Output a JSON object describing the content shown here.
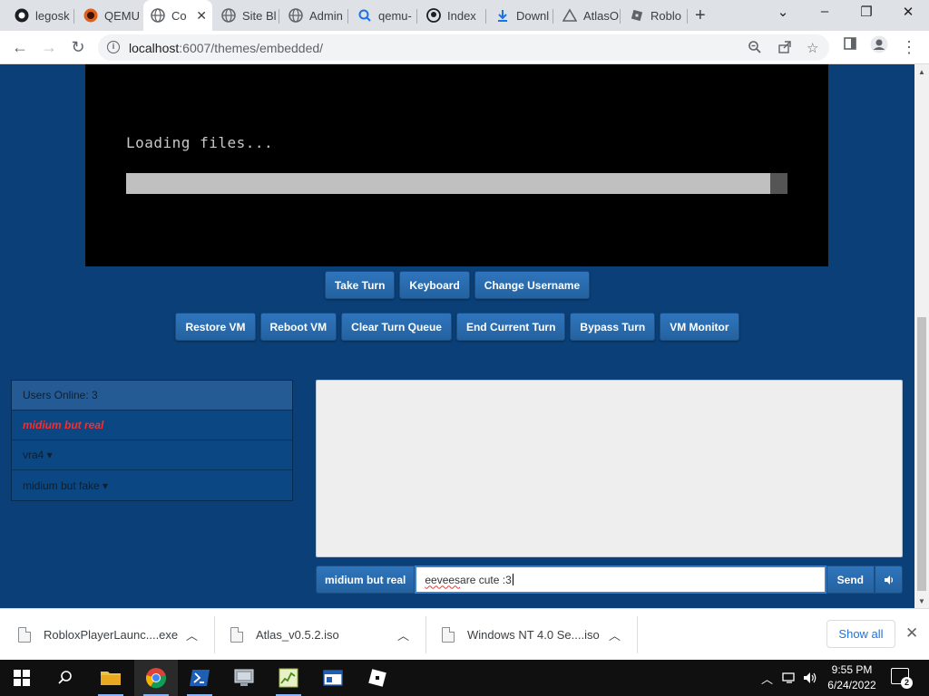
{
  "browser": {
    "tabs": [
      {
        "title": "legosk",
        "icon": "github-icon"
      },
      {
        "title": "QEMU",
        "icon": "qemu-icon"
      },
      {
        "title": "Co",
        "icon": "globe-icon",
        "active": true
      },
      {
        "title": "Site Bl",
        "icon": "globe-icon"
      },
      {
        "title": "Admin",
        "icon": "globe-icon"
      },
      {
        "title": "qemu-",
        "icon": "search-icon"
      },
      {
        "title": "Index",
        "icon": "github-icon"
      },
      {
        "title": "Downl",
        "icon": "download-icon"
      },
      {
        "title": "AtlasO",
        "icon": "atlas-icon"
      },
      {
        "title": "Roblo",
        "icon": "roblox-icon"
      }
    ],
    "url_host": "localhost",
    "url_path": ":6007/themes/embedded/"
  },
  "vm": {
    "loading_text": "Loading files...",
    "progress": 0.974
  },
  "controls": {
    "row1": [
      "Take Turn",
      "Keyboard",
      "Change Username"
    ],
    "row2": [
      "Restore VM",
      "Reboot VM",
      "Clear Turn Queue",
      "End Current Turn",
      "Bypass Turn",
      "VM Monitor"
    ]
  },
  "users": {
    "header": "Users Online: 3",
    "list": [
      {
        "name": "midium but real",
        "self": true
      },
      {
        "name": "vra4 ▾",
        "self": false
      },
      {
        "name": "midium but fake ▾",
        "self": false
      }
    ]
  },
  "chat": {
    "username": "midium but real",
    "input_word1": "eevees",
    "input_rest": " are cute :3",
    "send_label": "Send",
    "sound_icon": "speaker-icon"
  },
  "downloads": {
    "items": [
      {
        "name": "RobloxPlayerLaunc....exe"
      },
      {
        "name": "Atlas_v0.5.2.iso"
      },
      {
        "name": "Windows NT 4.0 Se....iso"
      }
    ],
    "show_all": "Show all"
  },
  "taskbar": {
    "time": "9:55 PM",
    "date": "6/24/2022",
    "notifications": "2"
  },
  "colors": {
    "page_bg": "#0b3f77",
    "button": "#2f75bd",
    "self_user": "#ff2b2b"
  }
}
